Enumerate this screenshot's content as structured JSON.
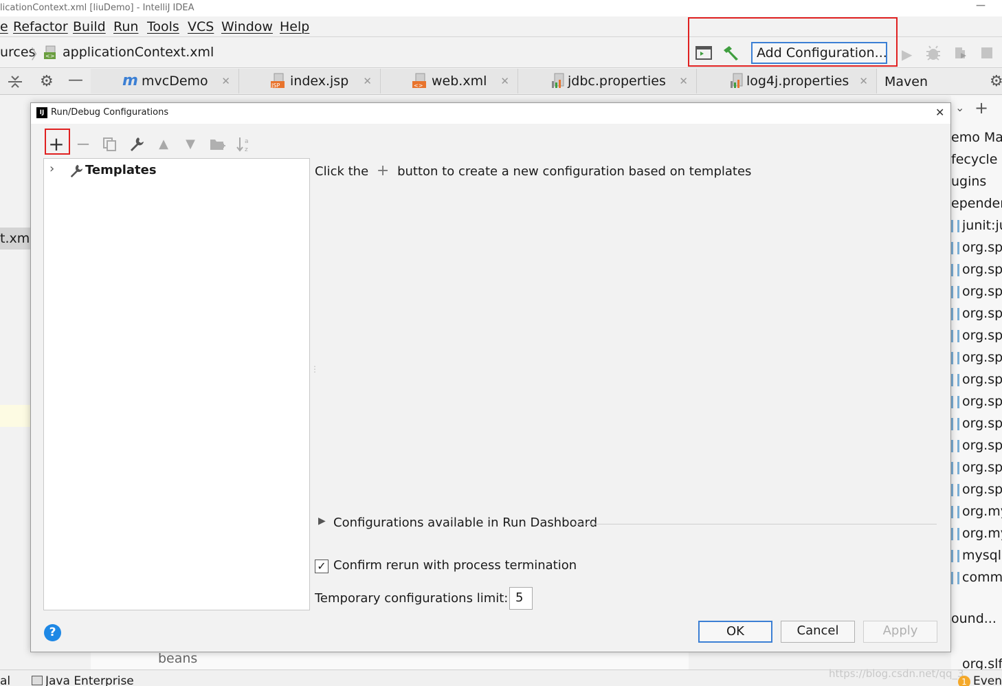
{
  "window": {
    "title": "licationContext.xml [liuDemo] - IntelliJ IDEA",
    "minimize_glyph": "—"
  },
  "menu": [
    "e",
    "Refactor",
    "Build",
    "Run",
    "Tools",
    "VCS",
    "Window",
    "Help"
  ],
  "breadcrumb": {
    "parent": "urces",
    "file": "applicationContext.xml"
  },
  "toolbar": {
    "add_configuration_label": "Add Configuration..."
  },
  "tabs": [
    {
      "label": "mvcDemo",
      "icon": "maven-m-icon"
    },
    {
      "label": "index.jsp",
      "icon": "jsp-file-icon"
    },
    {
      "label": "web.xml",
      "icon": "xml-file-icon"
    },
    {
      "label": "jdbc.properties",
      "icon": "properties-file-icon"
    },
    {
      "label": "log4j.properties",
      "icon": "properties-file-icon"
    }
  ],
  "maven_panel": {
    "title": "Maven",
    "items": [
      "emo Ma",
      "fecycle",
      "ugins",
      "ependen",
      "junit:ju",
      "org.spr",
      "org.spr",
      "org.spr",
      "org.spr",
      "org.spr",
      "org.spr",
      "org.spr",
      "org.spr",
      "org.spr",
      "org.spr",
      "org.spr",
      "org.spr",
      "org.my",
      "org.my",
      "mysql:",
      "commo"
    ],
    "bottom_item": "ound...",
    "last_item": "org.slf"
  },
  "editor_left": {
    "truncated_file": "t.xml",
    "beans_text": "beans"
  },
  "dialog": {
    "title": "Run/Debug Configurations",
    "tree": {
      "templates_label": "Templates"
    },
    "hint_before": "Click the",
    "hint_after": "button to create a new configuration based on templates",
    "dashboard_label": "Configurations available in Run Dashboard",
    "confirm_rerun_label": "Confirm rerun with process termination",
    "confirm_rerun_checked": true,
    "temp_limit_label": "Temporary configurations limit:",
    "temp_limit_value": "5",
    "ok_label": "OK",
    "cancel_label": "Cancel",
    "apply_label": "Apply"
  },
  "statusbar": {
    "left_text": "al",
    "java_enterprise": "Java Enterprise",
    "event_text": "Event",
    "event_badge": "1"
  },
  "watermark": "https://blog.csdn.net/qq_3",
  "colors": {
    "highlight_red": "#e02020",
    "ok_border": "#3b7fd4",
    "help_blue": "#1e88e5",
    "green_build": "#3f9e3f"
  }
}
